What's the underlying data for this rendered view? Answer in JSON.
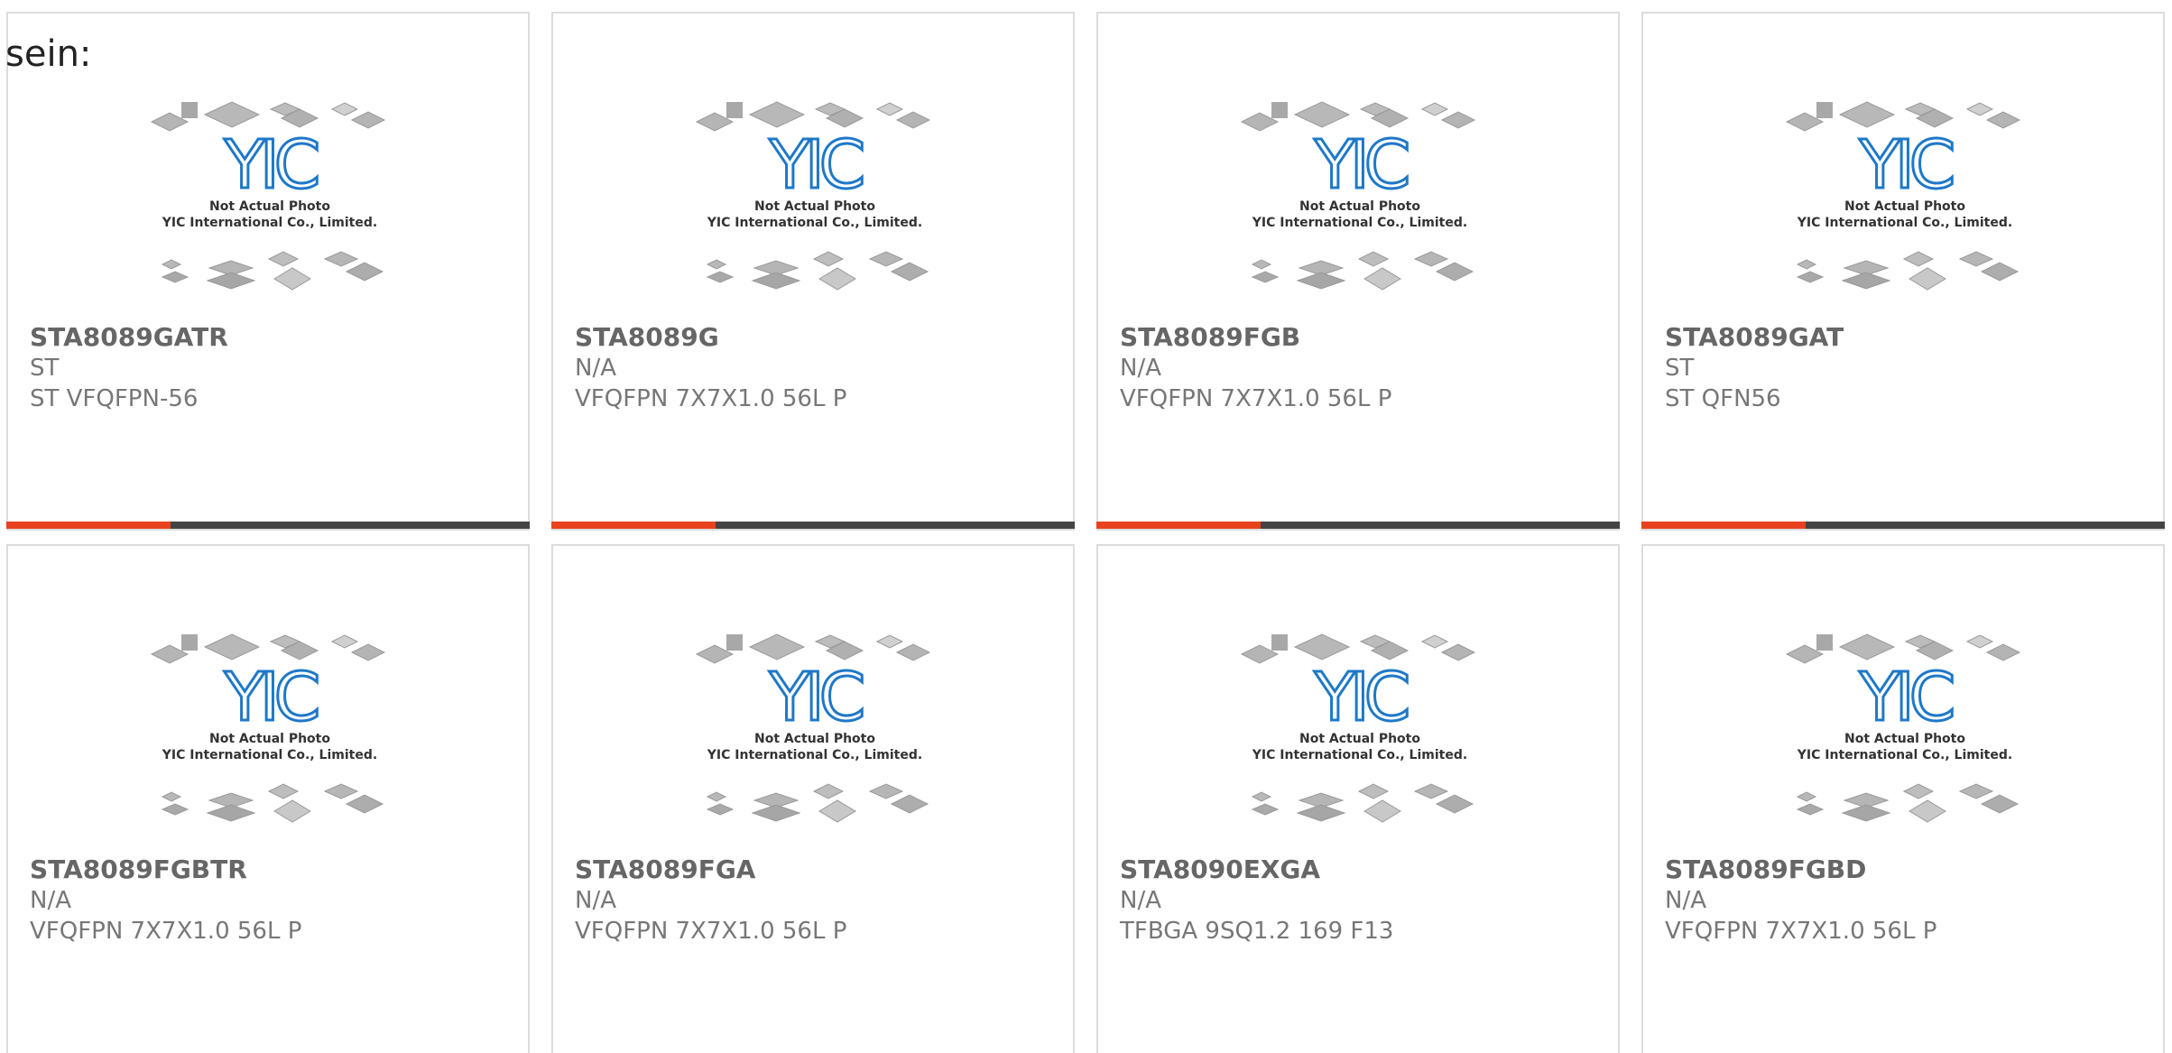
{
  "intro_text": "sein:",
  "thumbnail": {
    "caption_line1": "Not Actual Photo",
    "caption_line2": "YIC International Co., Limited.",
    "logo_text": "YIC"
  },
  "colors": {
    "accent": "#e8421f",
    "bar": "#444444",
    "logo_blue": "#1e78c8",
    "text_gray": "#666666"
  },
  "products": [
    {
      "part": "STA8089GATR",
      "manufacturer": "ST",
      "package": "ST VFQFPN-56"
    },
    {
      "part": "STA8089G",
      "manufacturer": "N/A",
      "package": "VFQFPN 7X7X1.0 56L P"
    },
    {
      "part": "STA8089FGB",
      "manufacturer": "N/A",
      "package": "VFQFPN 7X7X1.0 56L P"
    },
    {
      "part": "STA8089GAT",
      "manufacturer": "ST",
      "package": "ST QFN56"
    },
    {
      "part": "STA8089FGBTR",
      "manufacturer": "N/A",
      "package": "VFQFPN 7X7X1.0 56L P"
    },
    {
      "part": "STA8089FGA",
      "manufacturer": "N/A",
      "package": "VFQFPN 7X7X1.0 56L P"
    },
    {
      "part": "STA8090EXGA",
      "manufacturer": "N/A",
      "package": "TFBGA 9SQ1.2 169 F13"
    },
    {
      "part": "STA8089FGBD",
      "manufacturer": "N/A",
      "package": "VFQFPN 7X7X1.0 56L P"
    }
  ]
}
